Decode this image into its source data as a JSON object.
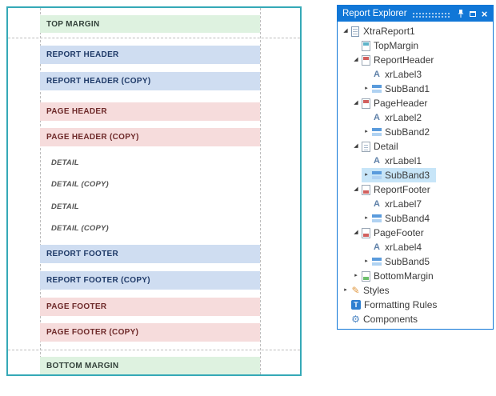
{
  "design_surface": {
    "bands": [
      {
        "label": "TOP MARGIN",
        "type": "margin"
      },
      {
        "label": "REPORT HEADER",
        "type": "report-header"
      },
      {
        "label": "REPORT HEADER (COPY)",
        "type": "report-header"
      },
      {
        "label": "PAGE HEADER",
        "type": "page-header"
      },
      {
        "label": "PAGE HEADER (COPY)",
        "type": "page-header"
      },
      {
        "label": "DETAIL",
        "type": "detail"
      },
      {
        "label": "DETAIL (COPY)",
        "type": "detail"
      },
      {
        "label": "DETAIL",
        "type": "detail"
      },
      {
        "label": "DETAIL (COPY)",
        "type": "detail"
      },
      {
        "label": "REPORT FOOTER",
        "type": "report-footer"
      },
      {
        "label": "REPORT FOOTER (COPY)",
        "type": "report-footer"
      },
      {
        "label": "PAGE FOOTER",
        "type": "page-footer"
      },
      {
        "label": "PAGE FOOTER (COPY)",
        "type": "page-footer"
      },
      {
        "label": "BOTTOM MARGIN",
        "type": "margin"
      }
    ]
  },
  "explorer": {
    "title": "Report Explorer",
    "tree": [
      {
        "label": "XtraReport1",
        "icon": "report",
        "state": "expanded",
        "level": 0
      },
      {
        "label": "TopMargin",
        "icon": "top-margin",
        "state": "none",
        "level": 1
      },
      {
        "label": "ReportHeader",
        "icon": "report-header",
        "state": "expanded",
        "level": 1
      },
      {
        "label": "xrLabel3",
        "icon": "label",
        "state": "none",
        "level": 2
      },
      {
        "label": "SubBand1",
        "icon": "sub-band",
        "state": "collapsed",
        "level": 2
      },
      {
        "label": "PageHeader",
        "icon": "page-header",
        "state": "expanded",
        "level": 1
      },
      {
        "label": "xrLabel2",
        "icon": "label",
        "state": "none",
        "level": 2
      },
      {
        "label": "SubBand2",
        "icon": "sub-band",
        "state": "collapsed",
        "level": 2
      },
      {
        "label": "Detail",
        "icon": "detail",
        "state": "expanded",
        "level": 1
      },
      {
        "label": "xrLabel1",
        "icon": "label",
        "state": "none",
        "level": 2
      },
      {
        "label": "SubBand3",
        "icon": "sub-band",
        "state": "collapsed",
        "level": 2,
        "selected": true
      },
      {
        "label": "ReportFooter",
        "icon": "report-footer",
        "state": "expanded",
        "level": 1
      },
      {
        "label": "xrLabel7",
        "icon": "label",
        "state": "none",
        "level": 2
      },
      {
        "label": "SubBand4",
        "icon": "sub-band",
        "state": "collapsed",
        "level": 2
      },
      {
        "label": "PageFooter",
        "icon": "page-footer",
        "state": "expanded",
        "level": 1
      },
      {
        "label": "xrLabel4",
        "icon": "label",
        "state": "none",
        "level": 2
      },
      {
        "label": "SubBand5",
        "icon": "sub-band",
        "state": "collapsed",
        "level": 2
      },
      {
        "label": "BottomMargin",
        "icon": "bottom-margin",
        "state": "collapsed",
        "level": 1
      },
      {
        "label": "Styles",
        "icon": "styles",
        "state": "collapsed",
        "level": 0
      },
      {
        "label": "Formatting Rules",
        "icon": "formatting-rules",
        "state": "none",
        "level": 0
      },
      {
        "label": "Components",
        "icon": "components",
        "state": "none",
        "level": 0
      }
    ]
  },
  "icons": {
    "expanded_arrow": "◢",
    "collapsed_arrow": "▸",
    "label_glyph": "A",
    "styles_glyph": "✎",
    "formatting_glyph": "T",
    "components_glyph": "⚙",
    "close_glyph": "×"
  },
  "colors": {
    "accent_blue": "#1177d7",
    "surface_border": "#35a9b7",
    "margin_band_bg": "#def2e0",
    "report_band_bg": "#cfddf1",
    "page_band_bg": "#f6dcdc",
    "selection_bg": "#c7e5f8"
  }
}
